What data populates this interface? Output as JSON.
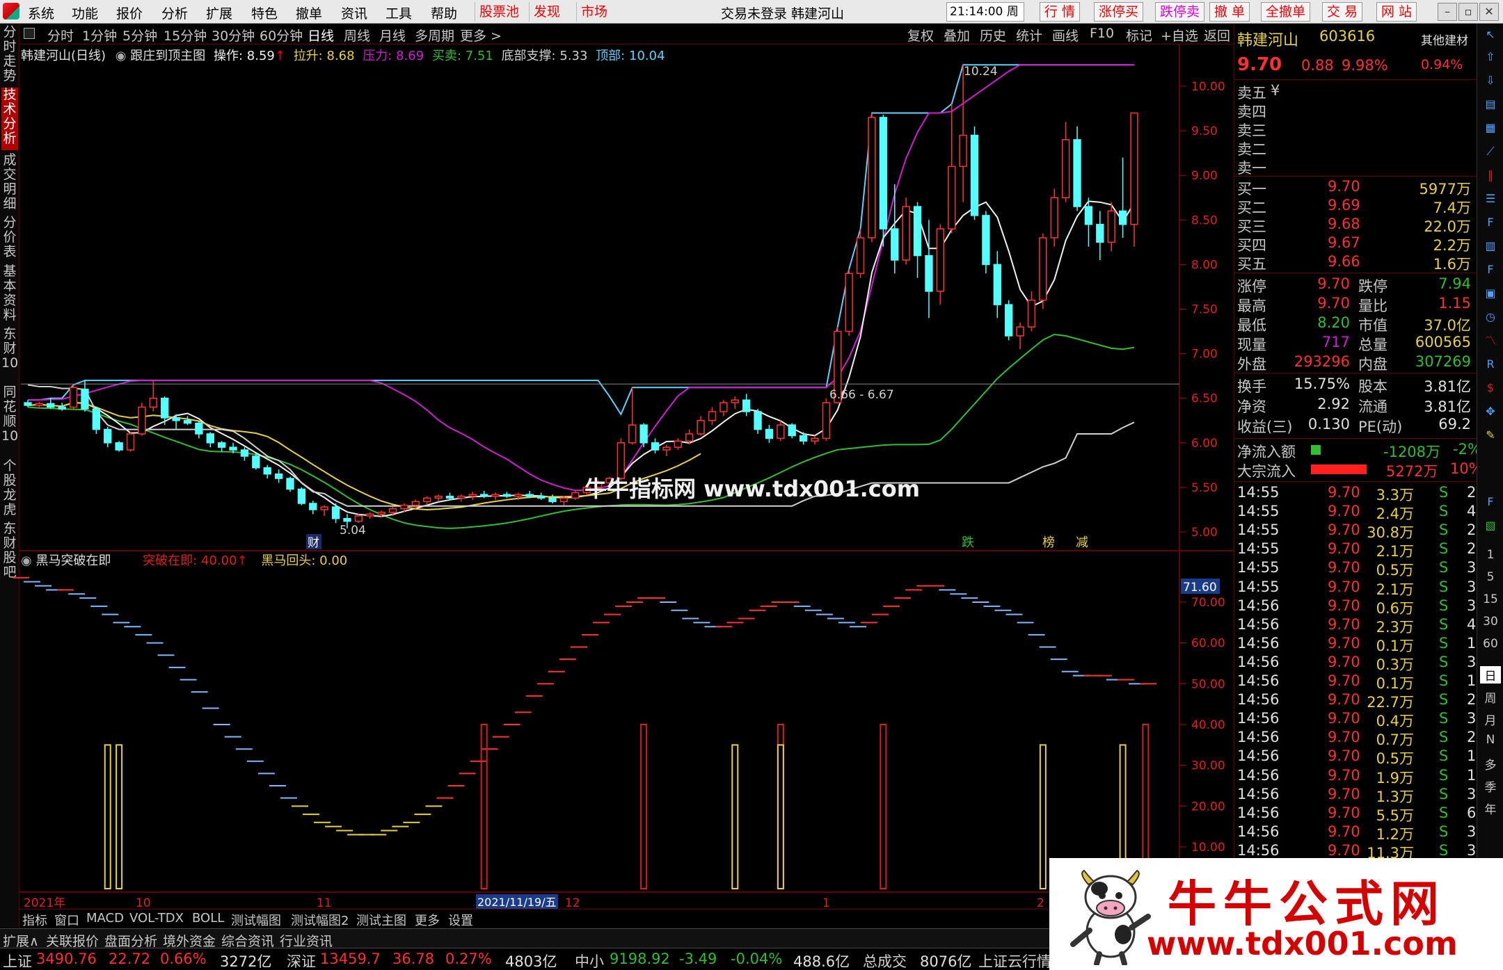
{
  "menubar": {
    "items": [
      "系统",
      "功能",
      "报价",
      "分析",
      "扩展",
      "特色",
      "撤单",
      "资讯",
      "工具",
      "帮助"
    ],
    "red_items": [
      "股票池",
      "发现",
      "市场"
    ],
    "title": "交易未登录  韩建河山",
    "clock": "21:14:00 周五",
    "right_buttons": [
      "行 情",
      "涨停买",
      "跌停卖",
      "撤 单",
      "全撤单",
      "交 易",
      "网 站"
    ]
  },
  "left_tabs": [
    {
      "label": "分时走势",
      "active": false
    },
    {
      "label": "技术分析",
      "active": true
    },
    {
      "label": "成交明细",
      "active": false
    },
    {
      "label": "分价表",
      "active": false
    },
    {
      "label": "基本资料",
      "active": false
    },
    {
      "label": "东财10",
      "active": false
    },
    {
      "label": "同花顺10",
      "active": false
    },
    {
      "label": "个股龙虎",
      "active": false
    },
    {
      "label": "东财股吧",
      "active": false
    }
  ],
  "period_bar": {
    "periods": [
      "分时",
      "1分钟",
      "5分钟",
      "15分钟",
      "30分钟",
      "60分钟",
      "日线",
      "周线",
      "月线",
      "多周期",
      "更多 >"
    ],
    "active": "日线",
    "tools": [
      "复权",
      "叠加",
      "历史",
      "统计",
      "画线",
      "F10",
      "标记",
      "+自选",
      "返回"
    ]
  },
  "main_info": {
    "stock": "韩建河山(日线)",
    "indicator": "跟庄到顶主图",
    "op_label": "操作:",
    "op_value": "8.59",
    "lasheng_label": "拉升:",
    "lasheng_value": "8.68",
    "yali_label": "压力:",
    "yali_value": "8.69",
    "maimai_label": "买卖:",
    "maimai_value": "7.51",
    "dibu_label": "底部支撑:",
    "dibu_value": "5.33",
    "dingbu_label": "顶部:",
    "dingbu_value": "10.04"
  },
  "price_axis": [
    "10.00",
    "9.50",
    "9.00",
    "8.50",
    "8.00",
    "7.50",
    "7.00",
    "6.50",
    "6.00",
    "5.50",
    "5.00"
  ],
  "annotations": {
    "high": "10.24",
    "low": "5.04",
    "range": "6.66 - 6.67",
    "cai": "财",
    "die": "跌",
    "bang": "榜",
    "jian": "减"
  },
  "sub_info": {
    "name": "黑马突破在即",
    "tupo_label": "突破在即:",
    "tupo_value": "40.00",
    "huitou_label": "黑马回头:",
    "huitou_value": "0.00",
    "current_value": "71.60"
  },
  "sub_axis": [
    "70.00",
    "60.00",
    "50.00",
    "40.00",
    "30.00",
    "20.00",
    "10.00"
  ],
  "date_axis": {
    "year": "2021年",
    "m10": "10",
    "m11": "11",
    "cursor": "2021/11/19/五",
    "m12": "12",
    "m1": "1",
    "m2": "2"
  },
  "quote": {
    "name": "韩建河山",
    "code": "603616",
    "sector": "其他建材",
    "price": "9.70",
    "change": "0.88",
    "pct": "9.98%",
    "sector_pct": "0.94%",
    "sell_labels": [
      "卖五",
      "卖四",
      "卖三",
      "卖二",
      "卖一"
    ],
    "sell_mark": "¥",
    "buys": [
      {
        "label": "买一",
        "price": "9.70",
        "vol": "5977万"
      },
      {
        "label": "买二",
        "price": "9.69",
        "vol": "7.4万"
      },
      {
        "label": "买三",
        "price": "9.68",
        "vol": "22.0万"
      },
      {
        "label": "买四",
        "price": "9.67",
        "vol": "2.2万"
      },
      {
        "label": "买五",
        "price": "9.66",
        "vol": "1.6万"
      }
    ],
    "stats": [
      {
        "l1": "涨停",
        "v1": "9.70",
        "l2": "跌停",
        "v2": "7.94"
      },
      {
        "l1": "最高",
        "v1": "9.70",
        "l2": "量比",
        "v2": "1.15"
      },
      {
        "l1": "最低",
        "v1": "8.20",
        "l2": "市值",
        "v2": "37.0亿"
      },
      {
        "l1": "现量",
        "v1": "717",
        "l2": "总量",
        "v2": "600565"
      },
      {
        "l1": "外盘",
        "v1": "293296",
        "l2": "内盘",
        "v2": "307269"
      }
    ],
    "stats2": [
      {
        "l1": "换手",
        "v1": "15.75%",
        "l2": "股本",
        "v2": "3.81亿"
      },
      {
        "l1": "净资",
        "v1": "2.92",
        "l2": "流通",
        "v2": "3.81亿"
      },
      {
        "l1": "收益(三)",
        "v1": "0.130",
        "l2": "PE(动)",
        "v2": "69.2"
      }
    ],
    "net_inflow": {
      "label": "净流入额",
      "value": "-1208万",
      "pct": "-2%"
    },
    "big_inflow": {
      "label": "大宗流入",
      "value": "5272万",
      "pct": "10%"
    }
  },
  "ticks": [
    {
      "t": "14:55",
      "p": "9.70",
      "v": "3.3万",
      "s": "S",
      "n": "2"
    },
    {
      "t": "14:55",
      "p": "9.70",
      "v": "2.4万",
      "s": "S",
      "n": "4"
    },
    {
      "t": "14:55",
      "p": "9.70",
      "v": "30.8万",
      "s": "S",
      "n": "2"
    },
    {
      "t": "14:55",
      "p": "9.70",
      "v": "2.1万",
      "s": "S",
      "n": "2"
    },
    {
      "t": "14:55",
      "p": "9.70",
      "v": "0.5万",
      "s": "S",
      "n": "3"
    },
    {
      "t": "14:55",
      "p": "9.70",
      "v": "2.1万",
      "s": "S",
      "n": "3"
    },
    {
      "t": "14:56",
      "p": "9.70",
      "v": "0.6万",
      "s": "S",
      "n": "3"
    },
    {
      "t": "14:56",
      "p": "9.70",
      "v": "2.3万",
      "s": "S",
      "n": "4"
    },
    {
      "t": "14:56",
      "p": "9.70",
      "v": "0.1万",
      "s": "S",
      "n": "1"
    },
    {
      "t": "14:56",
      "p": "9.70",
      "v": "0.3万",
      "s": "S",
      "n": "3"
    },
    {
      "t": "14:56",
      "p": "9.70",
      "v": "0.1万",
      "s": "S",
      "n": "1"
    },
    {
      "t": "14:56",
      "p": "9.70",
      "v": "22.7万",
      "s": "S",
      "n": "2"
    },
    {
      "t": "14:56",
      "p": "9.70",
      "v": "0.4万",
      "s": "S",
      "n": "3"
    },
    {
      "t": "14:56",
      "p": "9.70",
      "v": "0.7万",
      "s": "S",
      "n": "2"
    },
    {
      "t": "14:56",
      "p": "9.70",
      "v": "0.5万",
      "s": "S",
      "n": "1"
    },
    {
      "t": "14:56",
      "p": "9.70",
      "v": "1.9万",
      "s": "S",
      "n": "1"
    },
    {
      "t": "14:56",
      "p": "9.70",
      "v": "1.3万",
      "s": "S",
      "n": "3"
    },
    {
      "t": "14:56",
      "p": "9.70",
      "v": "5.5万",
      "s": "S",
      "n": "6"
    },
    {
      "t": "14:56",
      "p": "9.70",
      "v": "1.2万",
      "s": "S",
      "n": "3"
    },
    {
      "t": "14:56",
      "p": "9.70",
      "v": "11.3万",
      "s": "S",
      "n": "3"
    }
  ],
  "icon_strip_labels": [
    "1",
    "5",
    "15",
    "30",
    "60",
    "日",
    "周",
    "月",
    "N",
    "多",
    "季",
    "年"
  ],
  "bottom_tabs": [
    "指标",
    "窗口",
    "MACD",
    "VOL-TDX",
    "BOLL",
    "测试幅图",
    "测试幅图2",
    "测试主图",
    "更多",
    "设置"
  ],
  "info_tabs": [
    "扩展∧",
    "关联报价",
    "盘面分析",
    "境外资金",
    "综合资讯",
    "行业资讯"
  ],
  "index_bar": {
    "sh_label": "上证",
    "sh_value": "3490.76",
    "sh_chg": "22.72",
    "sh_pct": "0.66%",
    "sh_amt": "3272亿",
    "sz_label": "深证",
    "sz_value": "13459.7",
    "sz_chg": "36.78",
    "sz_pct": "0.27%",
    "sz_amt": "4803亿",
    "zx_label": "中小",
    "zx_value": "9198.92",
    "zx_chg": "-3.49",
    "zx_pct": "-0.04%",
    "zx_amt": "488.6亿",
    "total_label": "总成交",
    "total_value": "8076亿",
    "cloud": "上证云行情J"
  },
  "watermark": {
    "a": "牛牛指标网",
    "b": "www.tdx001.com"
  },
  "banner": {
    "title": "牛牛公式网",
    "url": "www.tdx001.com"
  },
  "chart_data": [
    {
      "type": "candlestick",
      "title": "韩建河山(日线)",
      "ylim": [
        4.9,
        10.4
      ],
      "candles": [
        [
          6.45,
          6.48,
          6.4,
          6.42
        ],
        [
          6.42,
          6.46,
          6.38,
          6.44
        ],
        [
          6.44,
          6.5,
          6.38,
          6.4
        ],
        [
          6.4,
          6.45,
          6.36,
          6.38
        ],
        [
          6.4,
          6.65,
          6.38,
          6.62
        ],
        [
          6.6,
          6.7,
          6.35,
          6.38
        ],
        [
          6.38,
          6.4,
          6.1,
          6.15
        ],
        [
          6.15,
          6.18,
          5.95,
          6.0
        ],
        [
          6.0,
          6.02,
          5.9,
          5.92
        ],
        [
          5.92,
          6.12,
          5.9,
          6.1
        ],
        [
          6.1,
          6.45,
          6.08,
          6.4
        ],
        [
          6.4,
          6.7,
          6.35,
          6.5
        ],
        [
          6.5,
          6.52,
          6.2,
          6.28
        ],
        [
          6.28,
          6.32,
          6.15,
          6.25
        ],
        [
          6.25,
          6.3,
          6.2,
          6.22
        ],
        [
          6.22,
          6.25,
          6.05,
          6.1
        ],
        [
          6.1,
          6.12,
          5.95,
          6.0
        ],
        [
          6.0,
          6.02,
          5.9,
          5.95
        ],
        [
          5.95,
          6.0,
          5.88,
          5.92
        ],
        [
          5.92,
          5.95,
          5.8,
          5.85
        ],
        [
          5.85,
          5.88,
          5.7,
          5.72
        ],
        [
          5.72,
          5.75,
          5.6,
          5.65
        ],
        [
          5.65,
          5.7,
          5.55,
          5.6
        ],
        [
          5.6,
          5.62,
          5.45,
          5.48
        ],
        [
          5.48,
          5.5,
          5.3,
          5.32
        ],
        [
          5.32,
          5.35,
          5.2,
          5.25
        ],
        [
          5.25,
          5.3,
          5.18,
          5.28
        ],
        [
          5.28,
          5.32,
          5.1,
          5.15
        ],
        [
          5.15,
          5.2,
          5.04,
          5.12
        ],
        [
          5.12,
          5.2,
          5.1,
          5.18
        ],
        [
          5.18,
          5.22,
          5.15,
          5.2
        ],
        [
          5.2,
          5.24,
          5.16,
          5.22
        ],
        [
          5.22,
          5.28,
          5.18,
          5.26
        ],
        [
          5.26,
          5.32,
          5.22,
          5.3
        ],
        [
          5.3,
          5.36,
          5.26,
          5.34
        ],
        [
          5.34,
          5.4,
          5.3,
          5.38
        ],
        [
          5.38,
          5.42,
          5.34,
          5.4
        ],
        [
          5.4,
          5.44,
          5.36,
          5.38
        ],
        [
          5.38,
          5.42,
          5.34,
          5.4
        ],
        [
          5.4,
          5.45,
          5.36,
          5.42
        ],
        [
          5.42,
          5.46,
          5.38,
          5.4
        ],
        [
          5.4,
          5.44,
          5.36,
          5.42
        ],
        [
          5.42,
          5.45,
          5.38,
          5.4
        ],
        [
          5.4,
          5.44,
          5.36,
          5.42
        ],
        [
          5.42,
          5.46,
          5.38,
          5.4
        ],
        [
          5.4,
          5.44,
          5.36,
          5.38
        ],
        [
          5.38,
          5.42,
          5.32,
          5.34
        ],
        [
          5.34,
          5.4,
          5.3,
          5.38
        ],
        [
          5.38,
          5.46,
          5.36,
          5.44
        ],
        [
          5.44,
          5.52,
          5.42,
          5.5
        ],
        [
          5.5,
          5.58,
          5.48,
          5.55
        ],
        [
          5.55,
          5.62,
          5.52,
          5.6
        ],
        [
          5.6,
          6.05,
          5.58,
          6.0
        ],
        [
          6.0,
          6.62,
          5.98,
          6.2
        ],
        [
          6.2,
          6.22,
          5.95,
          6.0
        ],
        [
          6.0,
          6.05,
          5.88,
          5.92
        ],
        [
          5.92,
          5.98,
          5.85,
          5.95
        ],
        [
          5.95,
          6.05,
          5.92,
          6.02
        ],
        [
          6.02,
          6.15,
          5.98,
          6.1
        ],
        [
          6.1,
          6.3,
          6.08,
          6.25
        ],
        [
          6.25,
          6.4,
          6.2,
          6.35
        ],
        [
          6.35,
          6.48,
          6.3,
          6.45
        ],
        [
          6.45,
          6.52,
          6.38,
          6.48
        ],
        [
          6.48,
          6.55,
          6.3,
          6.35
        ],
        [
          6.35,
          6.38,
          6.1,
          6.15
        ],
        [
          6.15,
          6.2,
          6.0,
          6.05
        ],
        [
          6.05,
          6.25,
          6.02,
          6.2
        ],
        [
          6.2,
          6.22,
          6.05,
          6.08
        ],
        [
          6.08,
          6.12,
          5.98,
          6.02
        ],
        [
          6.02,
          6.08,
          5.98,
          6.05
        ],
        [
          6.05,
          6.5,
          6.02,
          6.45
        ],
        [
          6.45,
          7.3,
          6.44,
          7.25
        ],
        [
          7.25,
          7.95,
          7.2,
          7.9
        ],
        [
          7.9,
          8.4,
          7.85,
          8.3
        ],
        [
          8.3,
          9.7,
          8.25,
          9.65
        ],
        [
          9.65,
          9.68,
          8.2,
          8.4
        ],
        [
          8.4,
          8.9,
          7.9,
          8.05
        ],
        [
          8.05,
          8.75,
          8.0,
          8.65
        ],
        [
          8.65,
          8.7,
          7.85,
          8.1
        ],
        [
          8.1,
          8.5,
          7.4,
          7.7
        ],
        [
          7.7,
          8.45,
          7.55,
          8.4
        ],
        [
          8.4,
          9.8,
          8.35,
          9.1
        ],
        [
          9.1,
          10.24,
          8.7,
          9.45
        ],
        [
          9.45,
          9.55,
          8.5,
          8.55
        ],
        [
          8.55,
          8.6,
          7.9,
          8.0
        ],
        [
          8.0,
          8.15,
          7.4,
          7.55
        ],
        [
          7.55,
          7.6,
          7.15,
          7.2
        ],
        [
          7.2,
          7.35,
          7.05,
          7.3
        ],
        [
          7.3,
          7.7,
          7.25,
          7.6
        ],
        [
          7.6,
          8.35,
          7.5,
          8.3
        ],
        [
          8.3,
          8.85,
          8.2,
          8.75
        ],
        [
          8.75,
          9.6,
          8.7,
          9.4
        ],
        [
          9.4,
          9.55,
          8.6,
          8.65
        ],
        [
          8.65,
          8.75,
          8.2,
          8.45
        ],
        [
          8.45,
          8.6,
          8.05,
          8.25
        ],
        [
          8.25,
          8.7,
          8.15,
          8.6
        ],
        [
          8.6,
          9.2,
          8.3,
          8.45
        ],
        [
          8.45,
          9.7,
          8.2,
          9.7
        ]
      ],
      "series": [
        {
          "name": "顶部",
          "color": "#5fd3ff",
          "type": "step"
        },
        {
          "name": "压力",
          "color": "#d01ed0"
        },
        {
          "name": "买卖",
          "color": "#2fbf2f"
        },
        {
          "name": "操作",
          "color": "#f0f0f0"
        },
        {
          "name": "拉升",
          "color": "#e8d040"
        },
        {
          "name": "底部支撑",
          "color": "#d0d0d0",
          "type": "step"
        }
      ]
    },
    {
      "type": "bar",
      "title": "黑马突破在即",
      "ylim": [
        0,
        80
      ],
      "oscillator": [
        76,
        75,
        74,
        73,
        73,
        72,
        71,
        69,
        67,
        65,
        64,
        62,
        60,
        57,
        54,
        51,
        48,
        44,
        40,
        37,
        34,
        31,
        28,
        25,
        22,
        20,
        18,
        16,
        15,
        14,
        13,
        13,
        13,
        14,
        15,
        16,
        18,
        20,
        22,
        25,
        28,
        31,
        34,
        37,
        40,
        43,
        47,
        50,
        53,
        56,
        59,
        62,
        65,
        67,
        69,
        70,
        71,
        71,
        70,
        68,
        66,
        65,
        64,
        64,
        65,
        66,
        68,
        69,
        70,
        70,
        69,
        68,
        67,
        66,
        65,
        64,
        65,
        67,
        69,
        71,
        73,
        74,
        74,
        73,
        72,
        71,
        70,
        69,
        68,
        67,
        65,
        62,
        59,
        56,
        53,
        52,
        52,
        52,
        51,
        51,
        50,
        50
      ],
      "signals": [
        {
          "idx": 7,
          "value": 35,
          "color": "#e8d040"
        },
        {
          "idx": 8,
          "value": 35,
          "color": "#e8d040"
        },
        {
          "idx": 40,
          "value": 40,
          "color": "#d02020"
        },
        {
          "idx": 54,
          "value": 40,
          "color": "#d02020"
        },
        {
          "idx": 62,
          "value": 35,
          "color": "#e8d040"
        },
        {
          "idx": 66,
          "value": 40,
          "color": "#d02020"
        },
        {
          "idx": 66,
          "value": 35,
          "color": "#e8d040"
        },
        {
          "idx": 75,
          "value": 40,
          "color": "#d02020"
        },
        {
          "idx": 89,
          "value": 35,
          "color": "#e8d040"
        },
        {
          "idx": 96,
          "value": 35,
          "color": "#e8d040"
        },
        {
          "idx": 98,
          "value": 40,
          "color": "#d02020"
        }
      ]
    }
  ]
}
